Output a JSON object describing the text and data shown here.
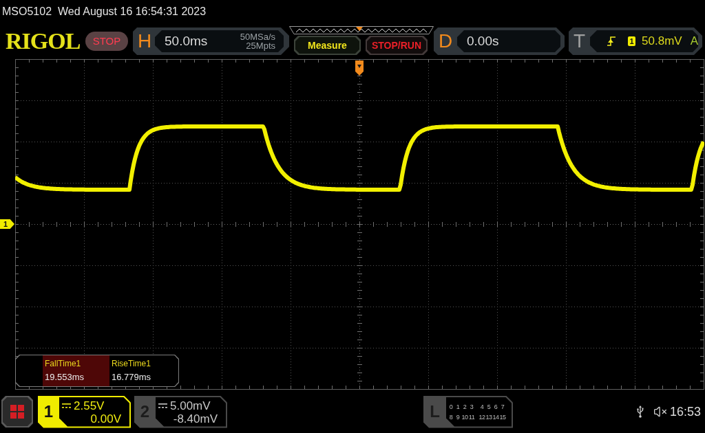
{
  "status_line": {
    "model": "MSO5102",
    "datetime": "Wed August 16 16:54:31 2023"
  },
  "header": {
    "logo": "RIGOL",
    "run_status": "STOP",
    "horizontal": {
      "label": "H",
      "timebase": "50.0ms",
      "sample_rate": "50MSa/s",
      "memory_depth": "25Mpts"
    },
    "buttons": [
      {
        "label": "Measure",
        "kind": "measure"
      },
      {
        "label": "STOP/RUN",
        "kind": "run_stop"
      }
    ],
    "delay": {
      "label": "D",
      "value": "0.00s"
    },
    "trigger": {
      "label": "T",
      "rising_edge": true,
      "source": "1",
      "level": "50.8mV",
      "mode": "A"
    }
  },
  "channel_marker": "1",
  "measurements": [
    {
      "name": "FallTime1",
      "value": "19.553ms",
      "selected": true
    },
    {
      "name": "RiseTime1",
      "value": "16.779ms",
      "selected": false
    }
  ],
  "channels": [
    {
      "number": "1",
      "scale": "2.55V",
      "offset": "0.00V",
      "on": true
    },
    {
      "number": "2",
      "scale": "5.00mV",
      "offset": "-8.40mV",
      "on": false
    }
  ],
  "logic": {
    "label": "L",
    "channels": [
      [
        "0",
        "1",
        "2",
        "3",
        "4",
        "5",
        "6",
        "7"
      ],
      [
        "8",
        "9",
        "10",
        "11",
        "12",
        "13",
        "14",
        "15"
      ]
    ]
  },
  "status_bar": {
    "time": "16:53"
  }
}
